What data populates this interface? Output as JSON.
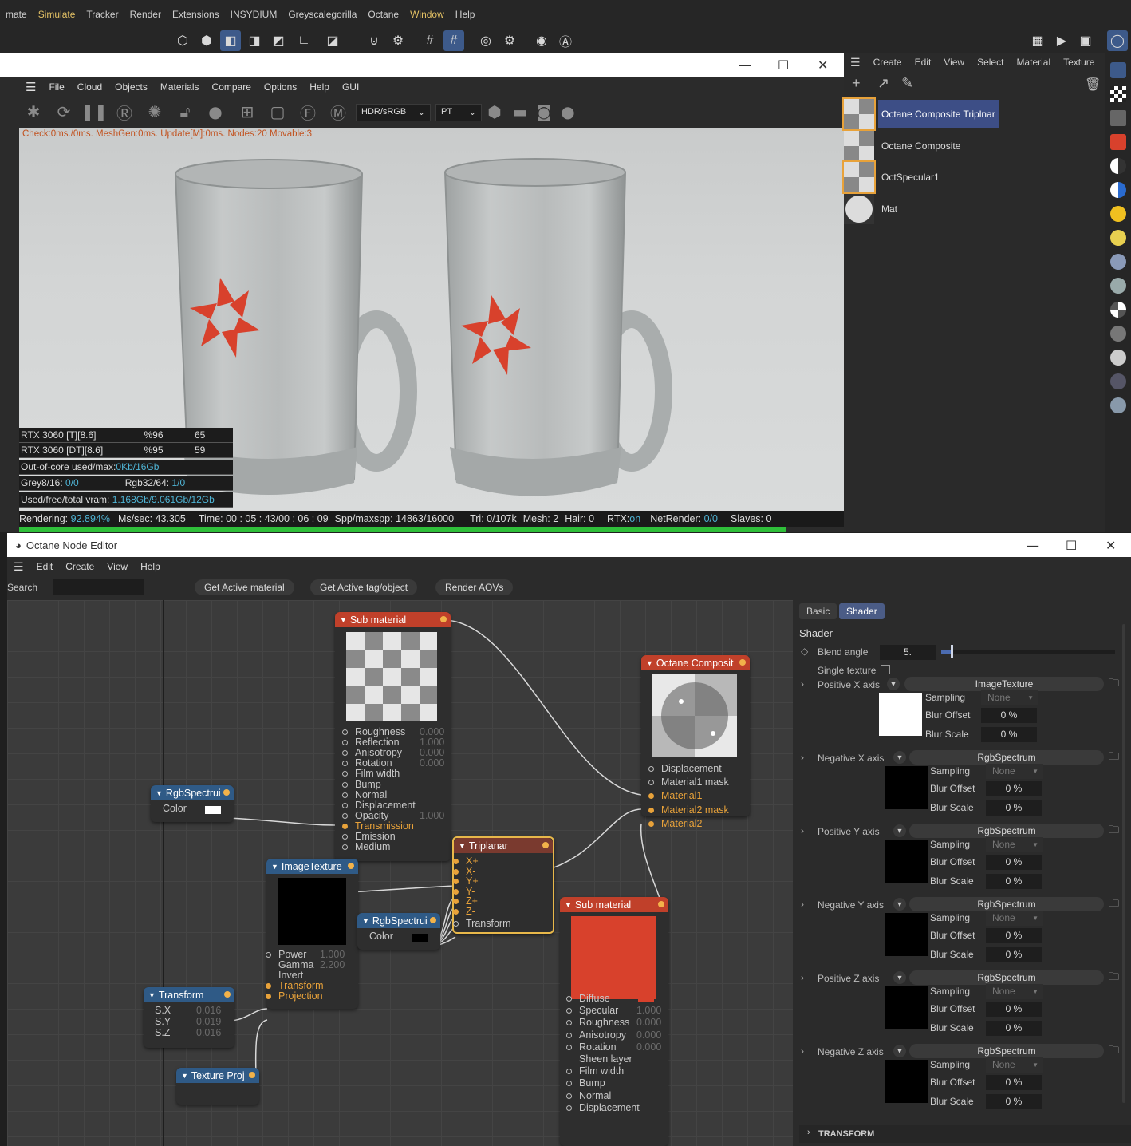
{
  "top_menu": [
    "mate",
    "Simulate",
    "Tracker",
    "Render",
    "Extensions",
    "INSYDIUM",
    "Greyscalegorilla",
    "Octane",
    "Window",
    "Help"
  ],
  "viewer": {
    "menu": [
      "File",
      "Cloud",
      "Objects",
      "Materials",
      "Compare",
      "Options",
      "Help",
      "GUI"
    ],
    "color_mode": "HDR/sRGB",
    "kernel": "PT",
    "check_line": "Check:0ms./0ms. MeshGen:0ms. Update[M]:0ms. Nodes:20 Movable:3",
    "gpu": [
      {
        "name": "RTX 3060 [T][8.6]",
        "pct": "%96",
        "temp": "65"
      },
      {
        "name": "RTX 3060 [DT][8.6]",
        "pct": "%95",
        "temp": "59"
      }
    ],
    "ooc_label": "Out-of-core used/max:",
    "ooc_value": "0Kb/16Gb",
    "grey_label": "Grey8/16:",
    "grey_value": "0/0",
    "rgb_label": "Rgb32/64:",
    "rgb_value": "1/0",
    "vram_label": "Used/free/total vram:",
    "vram_value": "1.168Gb/9.061Gb/12Gb",
    "rendering_label": "Rendering:",
    "rendering_value": "92.894%",
    "ms_label": "Ms/sec:",
    "ms_value": "43.305",
    "time_label": "Time:",
    "time_value": "00 : 05 : 43/00 : 06 : 09",
    "spp_label": "Spp/maxspp:",
    "spp_value": "14863/16000",
    "tri_label": "Tri:",
    "tri_value": "0/107k",
    "mesh_label": "Mesh:",
    "mesh_value": "2",
    "hair_label": "Hair:",
    "hair_value": "0",
    "rtx_label": "RTX:",
    "rtx_value": "on",
    "net_label": "NetRender:",
    "net_value": "0/0",
    "slaves_label": "Slaves:",
    "slaves_value": "0",
    "progress": 0.929
  },
  "material_manager": {
    "menu": [
      "Create",
      "Edit",
      "View",
      "Select",
      "Material",
      "Texture"
    ],
    "materials": [
      "Octane Composite Triplnar",
      "Octane Composite",
      "OctSpecular1",
      "Mat"
    ]
  },
  "editor": {
    "title": "Octane Node Editor",
    "menu": [
      "Edit",
      "Create",
      "View",
      "Help"
    ],
    "search_label": "Search",
    "buttons": [
      "Get Active material",
      "Get Active tag/object",
      "Render AOVs"
    ],
    "nodes": {
      "sub_material_1": {
        "title": "Sub material",
        "ports": [
          [
            "Roughness",
            "0.000"
          ],
          [
            "Reflection",
            "1.000"
          ],
          [
            "Anisotropy",
            "0.000"
          ],
          [
            "Rotation",
            "0.000"
          ],
          [
            "Film width",
            ""
          ],
          [
            "Bump",
            ""
          ],
          [
            "Normal",
            ""
          ],
          [
            "Displacement",
            ""
          ],
          [
            "Opacity",
            "1.000"
          ],
          [
            "Transmission",
            ""
          ],
          [
            "Emission",
            ""
          ],
          [
            "Medium",
            ""
          ]
        ]
      },
      "octane_composite": {
        "title": "Octane Composit",
        "ports": [
          "Displacement",
          "Material1 mask",
          "Material1",
          "Material2 mask",
          "Material2"
        ]
      },
      "rgb_1": {
        "title": "RgbSpectrui",
        "port": "Color"
      },
      "image_texture": {
        "title": "ImageTexture",
        "ports": [
          [
            "Power",
            "1.000"
          ],
          [
            "Gamma",
            "2.200"
          ],
          [
            "Invert",
            ""
          ],
          [
            "Transform",
            ""
          ],
          [
            "Projection",
            ""
          ]
        ]
      },
      "rgb_2": {
        "title": "RgbSpectrui",
        "port": "Color"
      },
      "triplanar": {
        "title": "Triplanar",
        "ports": [
          "X+",
          "X-",
          "Y+",
          "Y-",
          "Z+",
          "Z-",
          "Transform"
        ]
      },
      "sub_material_2": {
        "title": "Sub material",
        "ports": [
          [
            "Diffuse",
            ""
          ],
          [
            "Specular",
            "1.000"
          ],
          [
            "Roughness",
            "0.000"
          ],
          [
            "Anisotropy",
            "0.000"
          ],
          [
            "Rotation",
            "0.000"
          ],
          [
            "Sheen layer",
            ""
          ],
          [
            "Film width",
            ""
          ],
          [
            "Bump",
            ""
          ],
          [
            "Normal",
            ""
          ],
          [
            "Displacement",
            ""
          ]
        ]
      },
      "transform": {
        "title": "Transform",
        "ports": [
          [
            "S.X",
            "0.016"
          ],
          [
            "S.Y",
            "0.019"
          ],
          [
            "S.Z",
            "0.016"
          ]
        ]
      },
      "texture_proj": {
        "title": "Texture Proj"
      }
    },
    "inspector": {
      "tabs": [
        "Basic",
        "Shader"
      ],
      "section": "Shader",
      "blend_angle_label": "Blend angle",
      "blend_angle_value": "5.",
      "single_texture_label": "Single texture",
      "sampling_label": "Sampling",
      "sampling_value": "None",
      "blur_offset_label": "Blur Offset",
      "blur_scale_label": "Blur Scale",
      "percent": "0 %",
      "axes": [
        {
          "label": "Positive X axis",
          "shader": "ImageTexture",
          "color": "#ffffff"
        },
        {
          "label": "Negative X axis",
          "shader": "RgbSpectrum",
          "color": "#000000"
        },
        {
          "label": "Positive Y axis",
          "shader": "RgbSpectrum",
          "color": "#000000"
        },
        {
          "label": "Negative Y axis",
          "shader": "RgbSpectrum",
          "color": "#000000"
        },
        {
          "label": "Positive Z axis",
          "shader": "RgbSpectrum",
          "color": "#000000"
        },
        {
          "label": "Negative Z axis",
          "shader": "RgbSpectrum",
          "color": "#000000"
        }
      ],
      "transform_label": "TRANSFORM"
    }
  },
  "colors": {
    "accent": "#e2c064",
    "node_red": "#c0402a",
    "node_blue": "#2f5a86",
    "logo_red": "#d8412c"
  }
}
